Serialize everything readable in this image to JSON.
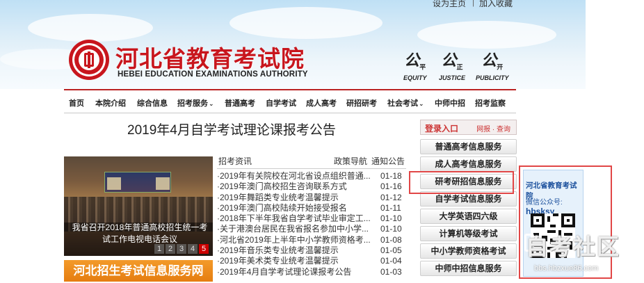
{
  "topbar": {
    "set_home": "设为主页",
    "separator": "|",
    "favorite": "加入收藏"
  },
  "header": {
    "logo_cn": "河北省教育考试院",
    "logo_en": "HEBEI EDUCATION EXAMINATIONS AUTHORITY",
    "mottos": [
      {
        "glyph": "公",
        "suffix": "平",
        "en": "EQUITY"
      },
      {
        "glyph": "公",
        "suffix": "正",
        "en": "JUSTICE"
      },
      {
        "glyph": "公",
        "suffix": "开",
        "en": "PUBLICITY"
      }
    ]
  },
  "nav": {
    "items": [
      {
        "label": "首页",
        "dropdown": ""
      },
      {
        "label": "本院介绍",
        "dropdown": ""
      },
      {
        "label": "综合信息",
        "dropdown": ""
      },
      {
        "label": "招考服务",
        "dropdown": "⌄"
      },
      {
        "label": "普通高考",
        "dropdown": ""
      },
      {
        "label": "自学考试",
        "dropdown": ""
      },
      {
        "label": "成人高考",
        "dropdown": ""
      },
      {
        "label": "研招研考",
        "dropdown": ""
      },
      {
        "label": "社会考试",
        "dropdown": "⌄"
      },
      {
        "label": "中师中招",
        "dropdown": ""
      },
      {
        "label": "招考监察",
        "dropdown": ""
      }
    ]
  },
  "article": {
    "title": "2019年4月自学考试理论课报考公告"
  },
  "slideshow": {
    "caption": "我省召开2018年普通高校招生统一考试工作电视电话会议",
    "pages": [
      "1",
      "2",
      "3",
      "4",
      "5"
    ],
    "active_page": "5"
  },
  "banner": {
    "label": "河北招生考试信息服务网"
  },
  "news": {
    "tabs": [
      "招考资讯",
      "政策导航",
      "通知公告"
    ],
    "items": [
      {
        "title": "·2019年有关院校在河北省设点组织普通...",
        "date": "01-18"
      },
      {
        "title": "·2019年澳门高校招生咨询联系方式",
        "date": "01-16"
      },
      {
        "title": "·2019年舞蹈类专业统考温馨提示",
        "date": "01-12"
      },
      {
        "title": "·2019年澳门高校陆续开始接受报名",
        "date": "01-11"
      },
      {
        "title": "·2018年下半年我省自学考试毕业审定工...",
        "date": "01-10"
      },
      {
        "title": "·关于港澳台居民在我省报名参加中小学...",
        "date": "01-10"
      },
      {
        "title": "·河北省2019年上半年中小学教师资格考...",
        "date": "01-08"
      },
      {
        "title": "·2019年音乐类专业统考温馨提示",
        "date": "01-05"
      },
      {
        "title": "·2019年美术类专业统考温馨提示",
        "date": "01-04"
      },
      {
        "title": "·2019年4月自学考试理论课报考公告",
        "date": "01-03"
      }
    ]
  },
  "services": {
    "login_title": "登录入口",
    "login_links": "网报 · 查询",
    "buttons": [
      "普通高考信息服务",
      "成人高考信息服务",
      "研考研招信息服务",
      "自学考试信息服务",
      "大学英语四六级",
      "计算机等级考试",
      "中小学教师资格考试",
      "中师中招信息服务"
    ]
  },
  "wechat": {
    "title": "河北省教育考试院",
    "sub_label": "微信公众号:",
    "account": "hbsksy"
  },
  "watermark": {
    "text": "自考社区",
    "url": "bbs.hbzxue86.com"
  },
  "colors": {
    "brand_red": "#c8161d",
    "highlight_red": "#e14646",
    "banner_orange": "#f0901f",
    "wechat_blue": "#1a4f9c"
  }
}
